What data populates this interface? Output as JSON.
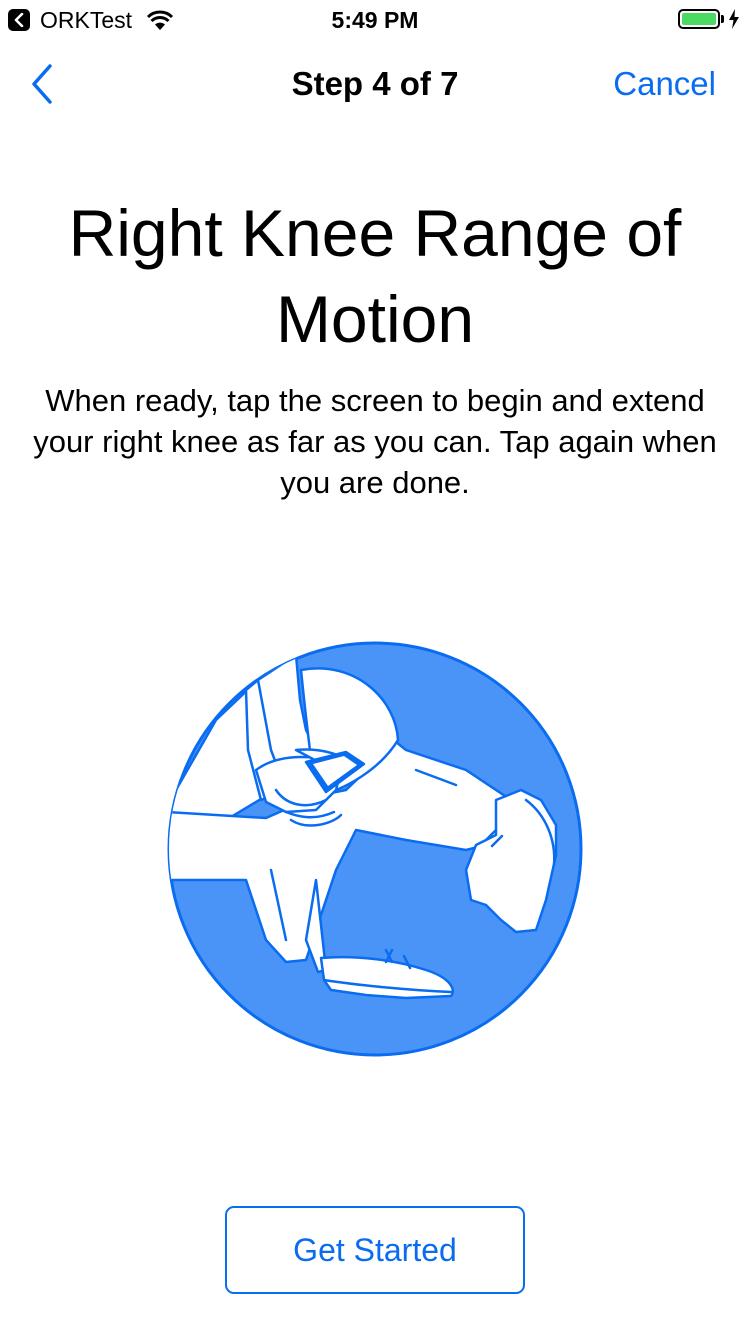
{
  "status_bar": {
    "back_app_label": "ORKTest",
    "time": "5:49 PM",
    "battery_color": "#4cd964"
  },
  "nav": {
    "title": "Step 4 of 7",
    "cancel_label": "Cancel",
    "back_icon": "chevron-left-icon"
  },
  "content": {
    "title": "Right Knee Range of Motion",
    "instruction": "When ready, tap the screen to begin and extend your right knee as far as you can. Tap again when you are done.",
    "illustration": "knee-extension-illustration"
  },
  "actions": {
    "get_started_label": "Get Started"
  },
  "colors": {
    "accent": "#0a6cf0",
    "illustration_fill": "#4a94f8"
  }
}
